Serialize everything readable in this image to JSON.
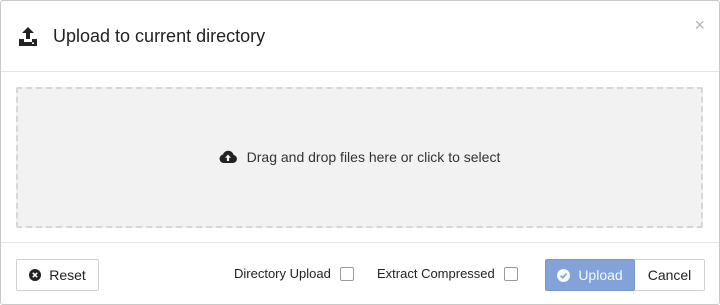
{
  "dialog": {
    "title": "Upload to current directory",
    "close_glyph": "×",
    "header_icon": "upload-icon"
  },
  "dropzone": {
    "text": "Drag and drop files here or click to select",
    "icon": "cloud-upload-icon"
  },
  "footer": {
    "reset_label": "Reset",
    "reset_icon": "times-circle-icon",
    "directory_upload_label": "Directory Upload",
    "directory_upload_checked": false,
    "extract_compressed_label": "Extract Compressed",
    "extract_compressed_checked": false,
    "upload_label": "Upload",
    "upload_icon": "check-circle-icon",
    "cancel_label": "Cancel"
  },
  "colors": {
    "primary_button": "#82a2d8",
    "dropzone_bg": "#f2f2f2"
  }
}
